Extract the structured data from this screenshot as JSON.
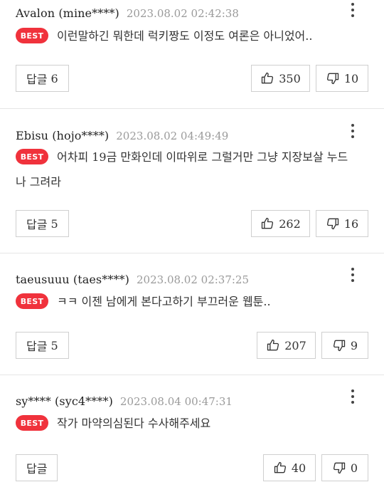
{
  "reply_label": "답글",
  "best_label": "BEST",
  "comments": [
    {
      "author": "Avalon (mine****)",
      "date": "2023.08.02 02:42:38",
      "text_line1": "이런말하긴 뭐한데 럭키짱도 이정도 여론은 아니었어..",
      "text_line2": "",
      "reply_count": "6",
      "likes": "350",
      "dislikes": "10"
    },
    {
      "author": "Ebisu (hojo****)",
      "date": "2023.08.02 04:49:49",
      "text_line1": "어차피 19금 만화인데 이따위로 그럴거만 그냥 지장보살 누드",
      "text_line2": "나 그려라",
      "reply_count": "5",
      "likes": "262",
      "dislikes": "16"
    },
    {
      "author": "taeusuuu (taes****)",
      "date": "2023.08.02 02:37:25",
      "text_line1": "ㅋㅋ 이젠 남에게 본다고하기 부끄러운 웹툰..",
      "text_line2": "",
      "reply_count": "5",
      "likes": "207",
      "dislikes": "9"
    },
    {
      "author": "sy**** (syc4****)",
      "date": "2023.08.04 00:47:31",
      "text_line1": "작가 마약의심된다 수사해주세요",
      "text_line2": "",
      "reply_count": "",
      "likes": "40",
      "dislikes": "0"
    }
  ]
}
